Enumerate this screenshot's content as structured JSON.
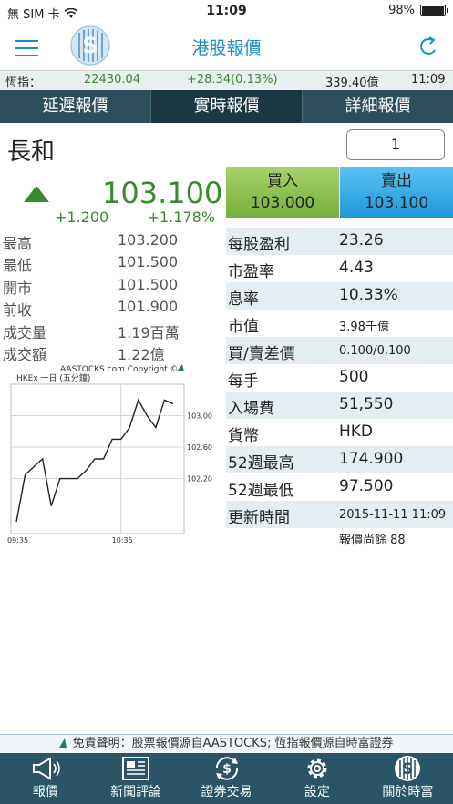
{
  "status": {
    "carrier": "無 SIM 卡",
    "time": "11:09",
    "battery": "98%"
  },
  "nav": {
    "title": "港股報價"
  },
  "ticker": {
    "label": "恆指：",
    "index": "22430.04",
    "change": "+28.34(0.13%)",
    "turnover": "339.40億",
    "time": "11:09"
  },
  "tabs": [
    {
      "label": "延遲報價"
    },
    {
      "label": "實時報價"
    },
    {
      "label": "詳細報價"
    }
  ],
  "stock": {
    "name": "長和",
    "quantity": "1",
    "price": "103.100",
    "change": "+1.200",
    "change_pct": "+1.178%"
  },
  "left_stats": [
    {
      "label": "最高",
      "value": "103.200"
    },
    {
      "label": "最低",
      "value": "101.500"
    },
    {
      "label": "開市",
      "value": "101.500"
    },
    {
      "label": "前收",
      "value": "101.900"
    },
    {
      "label": "成交量",
      "value": "1.19百萬"
    },
    {
      "label": "成交額",
      "value": "1.22億"
    }
  ],
  "buy": {
    "label": "買入",
    "value": "103.000"
  },
  "sell": {
    "label": "賣出",
    "value": "103.100"
  },
  "details": [
    {
      "label": "每股盈利",
      "value": "23.26"
    },
    {
      "label": "市盈率",
      "value": "4.43"
    },
    {
      "label": "息率",
      "value": "10.33%"
    },
    {
      "label": "市值",
      "value": "3.98千億"
    },
    {
      "label": "買/賣差價",
      "value": "0.100/0.100"
    },
    {
      "label": "每手",
      "value": "500"
    },
    {
      "label": "入場費",
      "value": "51,550"
    },
    {
      "label": "貨幣",
      "value": "HKD"
    },
    {
      "label": "52週最高",
      "value": "174.900"
    },
    {
      "label": "52週最低",
      "value": "97.500"
    },
    {
      "label": "更新時間",
      "value": "2015-11-11 11:09"
    }
  ],
  "remain": "報價尚餘 88",
  "chart": {
    "copyright": "AASTOCKS.com Copyright ©",
    "caption": "HKEx 一日 (五分鐘)",
    "y_ticks": [
      "103.00",
      "102.60",
      "102.20"
    ],
    "x_ticks": [
      "09:35",
      "10:35"
    ]
  },
  "chart_data": {
    "type": "line",
    "x": [
      "09:35",
      "09:40",
      "09:45",
      "09:50",
      "09:55",
      "10:00",
      "10:05",
      "10:10",
      "10:15",
      "10:20",
      "10:25",
      "10:30",
      "10:35",
      "10:40",
      "10:45",
      "10:50",
      "10:55",
      "11:00",
      "11:05"
    ],
    "series": [
      {
        "values": [
          101.65,
          102.25,
          102.35,
          102.45,
          101.85,
          102.2,
          102.2,
          102.2,
          102.3,
          102.45,
          102.45,
          102.7,
          102.7,
          102.85,
          103.2,
          103.0,
          102.85,
          103.2,
          103.15
        ]
      }
    ],
    "ylim": [
      101.5,
      103.4
    ],
    "y_ticks": [
      103.0,
      102.6,
      102.2
    ]
  },
  "disclaimer": "免責聲明：股票報價源自AASTOCKS; 恆指報價源自時富證券",
  "bottom_nav": [
    {
      "label": "報價",
      "icon": "megaphone-icon"
    },
    {
      "label": "新聞評論",
      "icon": "newspaper-icon"
    },
    {
      "label": "證券交易",
      "icon": "exchange-icon"
    },
    {
      "label": "設定",
      "icon": "gear-icon"
    },
    {
      "label": "關於時富",
      "icon": "cash-logo-icon"
    }
  ]
}
